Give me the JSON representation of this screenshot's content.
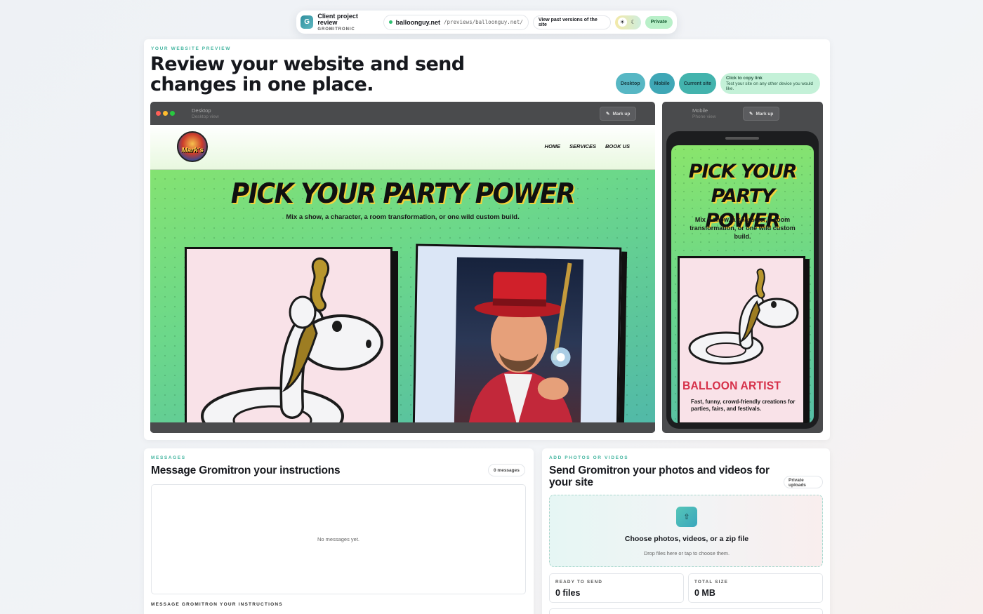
{
  "topbar": {
    "badge_letter": "G",
    "project_title": "Client project review",
    "project_sub": "GROMITRONIC",
    "domain": "balloonguy.net",
    "path": "/previews/balloonguy.net/",
    "past_versions_label": "View past versions of the site",
    "theme_light_icon": "☀",
    "theme_dark_icon": "☾",
    "private_label": "Private"
  },
  "preview": {
    "eyebrow": "YOUR WEBSITE PREVIEW",
    "headline": "Review your website and send changes in one place.",
    "view_buttons": [
      "Desktop",
      "Mobile",
      "Current site"
    ],
    "copy_link": {
      "title": "Click to copy link",
      "text": "Test your site on any other device you would like."
    },
    "desktop_frame": {
      "title": "Desktop",
      "subtitle": "Desktop view",
      "markup_label": "Mark up"
    },
    "mobile_frame": {
      "title": "Mobile",
      "subtitle": "Phone view",
      "markup_label": "Mark up"
    }
  },
  "site": {
    "logo_text": "Mark's",
    "nav": [
      "HOME",
      "SERVICES",
      "BOOK US"
    ],
    "hero_title": "PICK YOUR PARTY POWER",
    "hero_sub": "Mix a show, a character, a room transformation, or one wild custom build.",
    "mobile_title": "PICK YOUR PARTY POWER",
    "mobile_sub": "Mix a show, a character, a room transformation, or one wild custom build.",
    "card_title": "BALLOON ARTIST",
    "card_desc": "Fast, funny, crowd-friendly creations for parties, fairs, and festivals."
  },
  "messages": {
    "eyebrow": "MESSAGES",
    "title": "Message Gromitron your instructions",
    "count": "0 messages",
    "empty": "No messages yet.",
    "input_label": "MESSAGE GROMITRON YOUR INSTRUCTIONS"
  },
  "uploads": {
    "eyebrow": "ADD PHOTOS OR VIDEOS",
    "title": "Send Gromitron your photos and videos for your site",
    "private_label": "Private uploads",
    "drop_icon": "⇧",
    "drop_title": "Choose photos, videos, or a zip file",
    "drop_sub": "Drop files here or tap to choose them.",
    "ready_label": "READY TO SEND",
    "ready_value": "0 files",
    "size_label": "TOTAL SIZE",
    "size_value": "0 MB"
  },
  "colors": {
    "accent": "#44b5a0",
    "site_green": "#8ae56b",
    "site_teal": "#51b9a8",
    "private_green": "#b9f0c9"
  }
}
